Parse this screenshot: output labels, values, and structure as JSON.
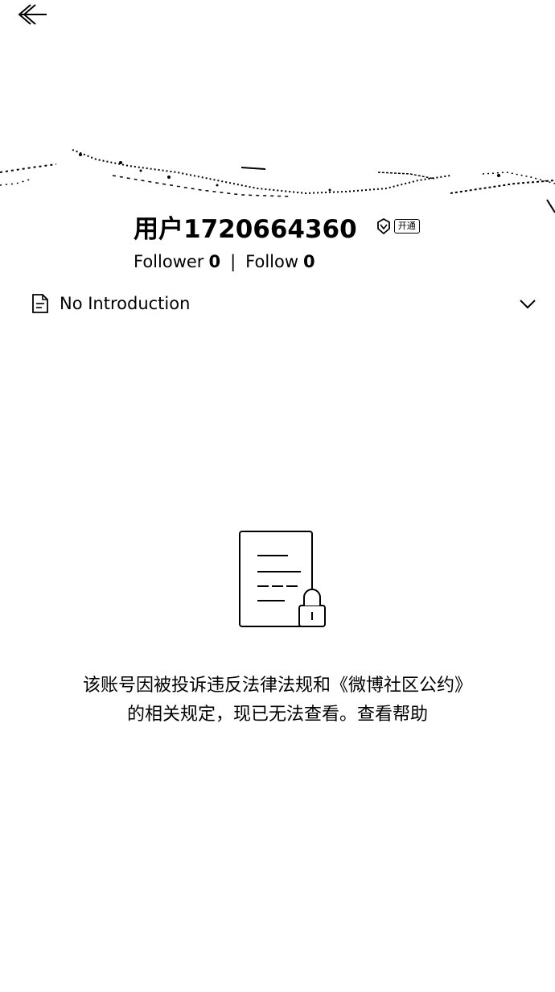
{
  "header": {
    "back_icon": "back-arrow-icon"
  },
  "profile": {
    "username": "用户1720664360",
    "vip_badge_label": "开通",
    "vip_icon": "vip-diamond-icon",
    "followers_label": "Follower",
    "followers_count": "0",
    "separator": "|",
    "following_label": "Follow",
    "following_count": "0"
  },
  "intro": {
    "icon": "document-icon",
    "text": "No Introduction",
    "expand_icon": "chevron-down-icon"
  },
  "notice": {
    "illustration": "locked-document-icon",
    "line1": "该账号因被投诉违反法律法规和《微博社区公约》",
    "line2": "的相关规定，现已无法查看。",
    "help_link": "查看帮助"
  }
}
